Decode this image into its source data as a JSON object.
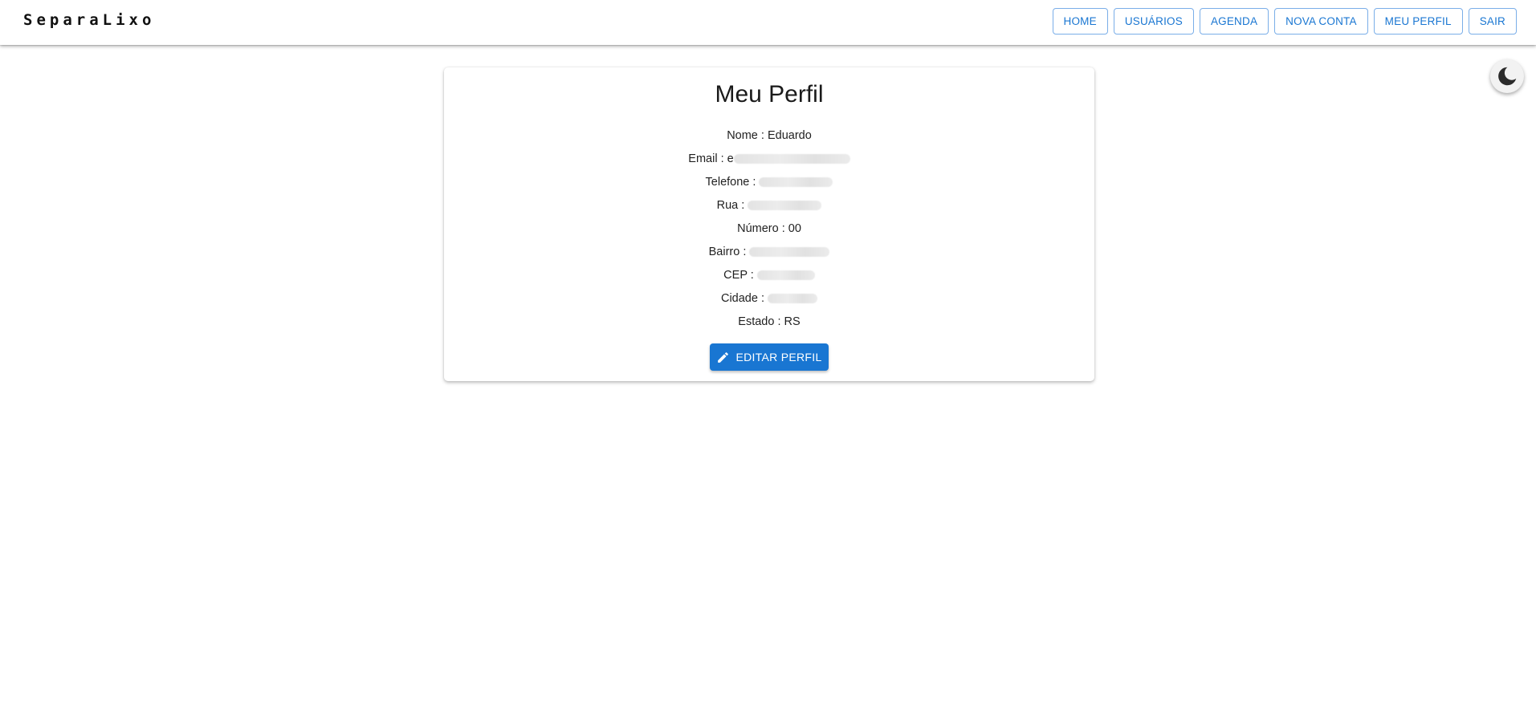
{
  "app": {
    "brand": "SeparaLixo"
  },
  "nav": {
    "items": [
      {
        "label": "HOME"
      },
      {
        "label": "USUÁRIOS"
      },
      {
        "label": "AGENDA"
      },
      {
        "label": "NOVA CONTA"
      },
      {
        "label": "MEU PERFIL"
      },
      {
        "label": "SAIR"
      }
    ]
  },
  "theme_toggle": {
    "icon": "moon-icon"
  },
  "profile": {
    "title": "Meu Perfil",
    "fields": [
      {
        "label": "Nome :",
        "value": "Eduardo",
        "redacted": false
      },
      {
        "label": "Email :",
        "value": "e",
        "redacted": true
      },
      {
        "label": "Telefone :",
        "value": "",
        "redacted": true
      },
      {
        "label": "Rua :",
        "value": "",
        "redacted": true
      },
      {
        "label": "Número :",
        "value": "00",
        "redacted": false
      },
      {
        "label": "Bairro :",
        "value": "",
        "redacted": true
      },
      {
        "label": "CEP :",
        "value": "",
        "redacted": true
      },
      {
        "label": "Cidade :",
        "value": "",
        "redacted": true
      },
      {
        "label": "Estado :",
        "value": "RS",
        "redacted": false
      }
    ],
    "edit_button": {
      "label": "EDITAR PERFIL",
      "icon": "pencil-icon"
    }
  },
  "colors": {
    "primary": "#1976d2",
    "nav_border": "#7aaee8"
  }
}
